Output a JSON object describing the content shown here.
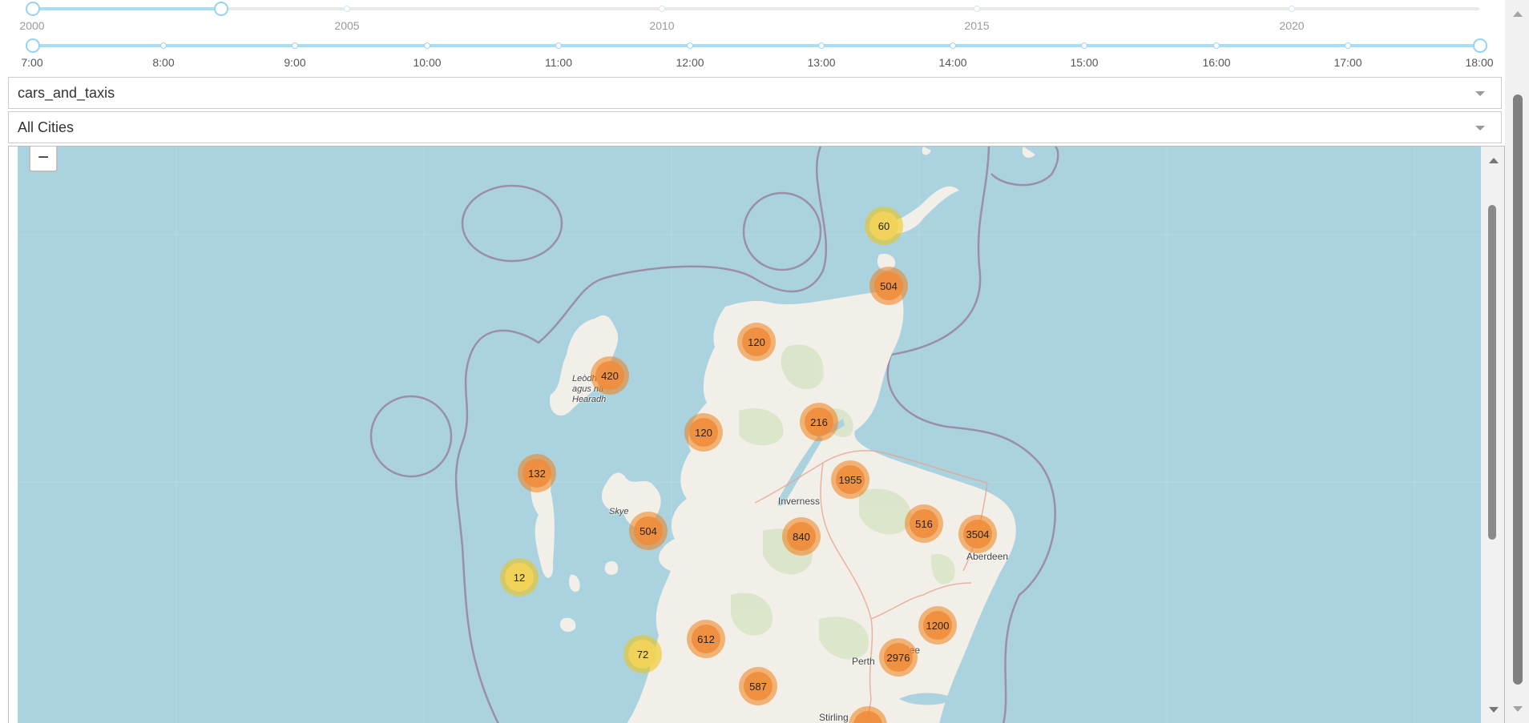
{
  "year_slider": {
    "labels": [
      "2000",
      "2005",
      "2010",
      "2015",
      "2020"
    ],
    "range_start": 2000,
    "range_end": 2003,
    "min": 2000,
    "max": 2023
  },
  "hour_slider": {
    "labels": [
      "7:00",
      "8:00",
      "9:00",
      "10:00",
      "11:00",
      "12:00",
      "13:00",
      "14:00",
      "15:00",
      "16:00",
      "17:00",
      "18:00"
    ],
    "range_start": "7:00",
    "range_end": "18:00"
  },
  "mode_dropdown": {
    "value": "cars_and_taxis"
  },
  "city_dropdown": {
    "value": "All Cities"
  },
  "map": {
    "zoom_out_label": "−",
    "places": {
      "inverness": "Inverness",
      "aberdeen": "Aberdeen",
      "perth": "Perth",
      "stirling": "Stirling",
      "dundee_partial": "lee",
      "skye": "Skye",
      "lewis_line1": "Leòdh",
      "lewis_line2": "agus na",
      "lewis_line3": "Hearadh"
    },
    "clusters": [
      {
        "count": "60",
        "color": "yellow"
      },
      {
        "count": "504",
        "color": "orange"
      },
      {
        "count": "120",
        "color": "orange"
      },
      {
        "count": "420",
        "color": "orange"
      },
      {
        "count": "120",
        "color": "orange"
      },
      {
        "count": "216",
        "color": "orange"
      },
      {
        "count": "132",
        "color": "orange"
      },
      {
        "count": "1955",
        "color": "orange"
      },
      {
        "count": "504",
        "color": "orange"
      },
      {
        "count": "840",
        "color": "orange"
      },
      {
        "count": "516",
        "color": "orange"
      },
      {
        "count": "3504",
        "color": "orange"
      },
      {
        "count": "12",
        "color": "yellow"
      },
      {
        "count": "1200",
        "color": "orange"
      },
      {
        "count": "612",
        "color": "orange"
      },
      {
        "count": "72",
        "color": "yellow"
      },
      {
        "count": "2976",
        "color": "orange"
      },
      {
        "count": "587",
        "color": "orange"
      },
      {
        "count": "",
        "color": "orange"
      }
    ],
    "colors": {
      "sea": "#aad3df",
      "land": "#f2efe9",
      "cluster_small": "#f1d357",
      "cluster_medium": "#f08c3c",
      "boundary": "#9b8fa8"
    }
  }
}
